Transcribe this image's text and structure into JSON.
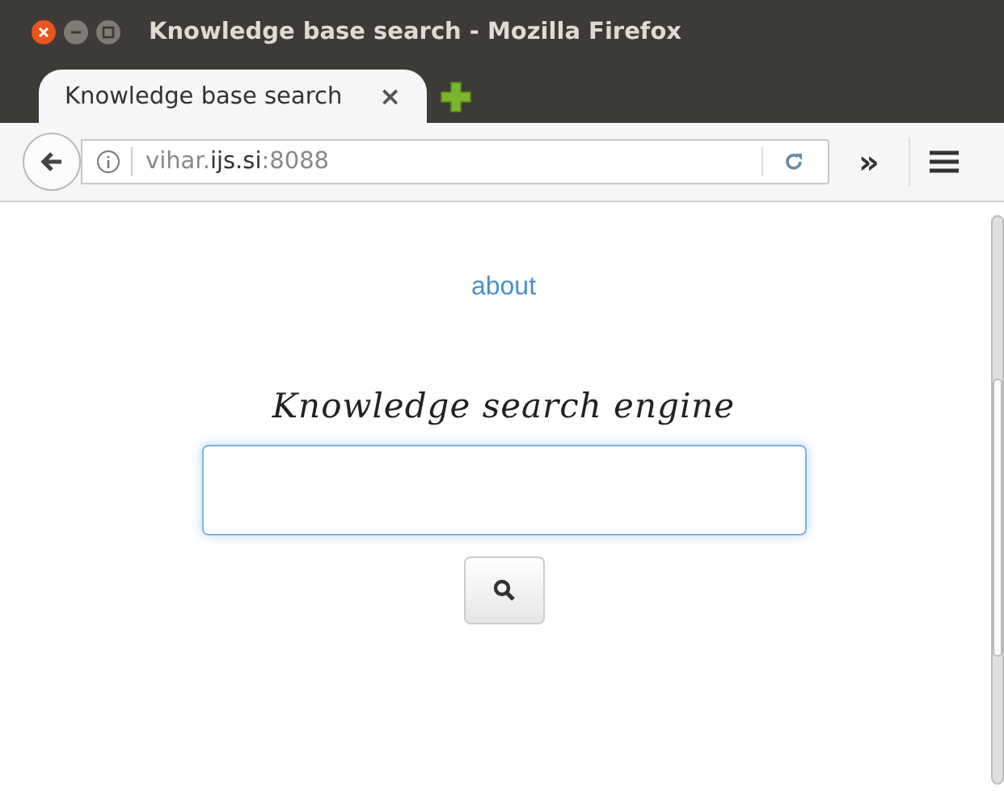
{
  "window": {
    "title": "Knowledge base search - Mozilla Firefox"
  },
  "tabs": [
    {
      "label": "Knowledge base search",
      "close": "×",
      "selected": true
    }
  ],
  "toolbar": {
    "url": "vihar.**ijs.si**:8088",
    "overflow": "»"
  },
  "page": {
    "link": "about",
    "heading": "Knowledge search engine"
  }
}
